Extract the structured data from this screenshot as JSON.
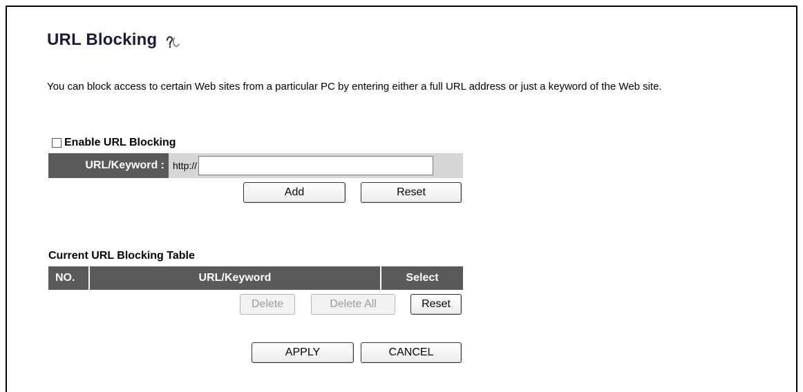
{
  "page": {
    "title": "URL Blocking",
    "help_icon": "help-icon",
    "description": "You can block access to certain Web sites from a particular PC by entering either a full URL address or just a keyword of the Web site."
  },
  "enable": {
    "label": "Enable URL Blocking",
    "checked": false
  },
  "url_form": {
    "label": "URL/Keyword :",
    "prefix": "http://",
    "value": "",
    "add_label": "Add",
    "reset_label": "Reset"
  },
  "table": {
    "title": "Current URL Blocking Table",
    "columns": [
      "NO.",
      "URL/Keyword",
      "Select"
    ],
    "rows": [],
    "delete_label": "Delete",
    "delete_all_label": "Delete All",
    "reset_label": "Reset"
  },
  "footer": {
    "apply_label": "APPLY",
    "cancel_label": "CANCEL"
  }
}
